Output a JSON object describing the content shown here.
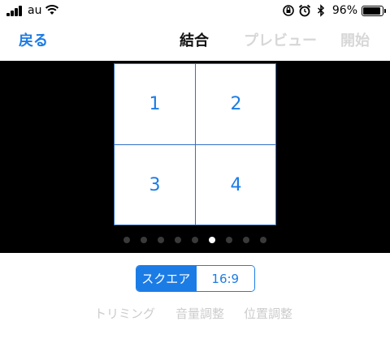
{
  "status_bar": {
    "carrier": "au",
    "battery_percent": "96%",
    "battery_level": 0.96
  },
  "nav": {
    "back_label": "戻る",
    "title": "結合",
    "preview_label": "プレビュー",
    "start_label": "開始"
  },
  "grid": {
    "cells": [
      "1",
      "2",
      "3",
      "4"
    ]
  },
  "pager": {
    "total_pages": 9,
    "current_page": 6
  },
  "aspect": {
    "options": [
      "スクエア",
      "16:9"
    ],
    "selected": "スクエア"
  },
  "tools": {
    "trim_label": "トリミング",
    "volume_label": "音量調整",
    "position_label": "位置調整"
  },
  "colors": {
    "accent": "#1c7ce6",
    "disabled_text": "#d7d7d7",
    "preview_background": "#000000"
  }
}
